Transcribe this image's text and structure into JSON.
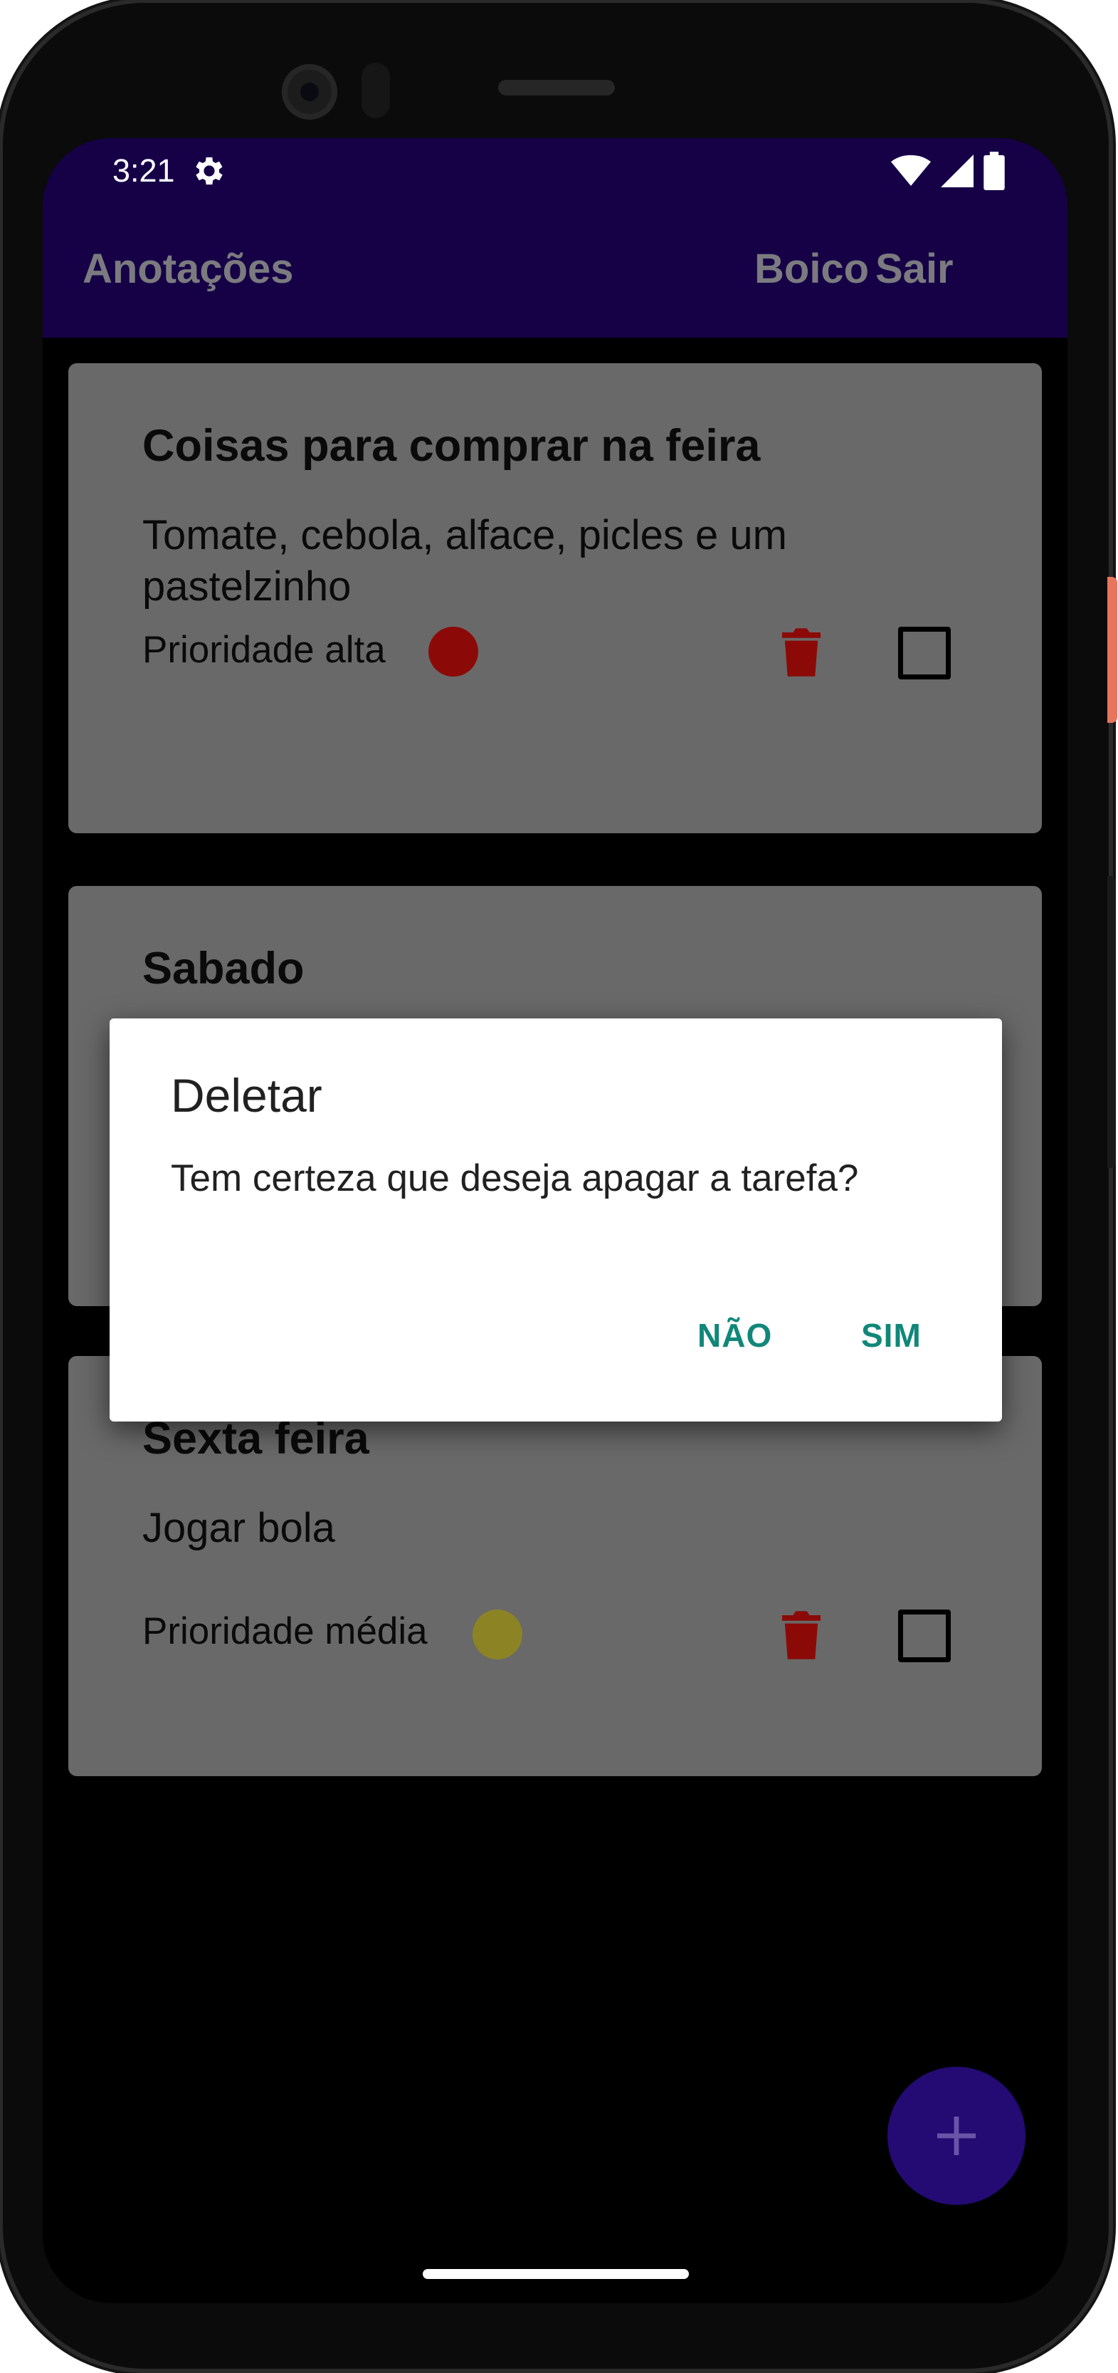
{
  "status_bar": {
    "time": "3:21"
  },
  "app_bar": {
    "title": "Anotações",
    "menu": [
      "Boico",
      "Sair"
    ]
  },
  "notes": [
    {
      "title": "Coisas para comprar na feira",
      "description": "Tomate, cebola, alface, picles e um pastelzinho",
      "priority_label": "Prioridade alta",
      "priority_color": "#8b0a07",
      "checked": false
    },
    {
      "title": "Sabado",
      "description": "",
      "priority_label": "",
      "priority_color": "",
      "checked": false
    },
    {
      "title": "Sexta feira",
      "description": "Jogar bola",
      "priority_label": "Prioridade média",
      "priority_color": "#8c8325",
      "checked": false
    }
  ],
  "dialog": {
    "title": "Deletar",
    "message": "Tem certeza que deseja apagar a tarefa?",
    "negative_button": "NÃO",
    "positive_button": "SIM"
  },
  "fab": {
    "icon": "plus-icon"
  },
  "colors": {
    "app_bar": "#160147",
    "card": "#696969",
    "dialog_accent": "#11877a",
    "trash": "#8b0a07",
    "fab": "#240a73"
  }
}
